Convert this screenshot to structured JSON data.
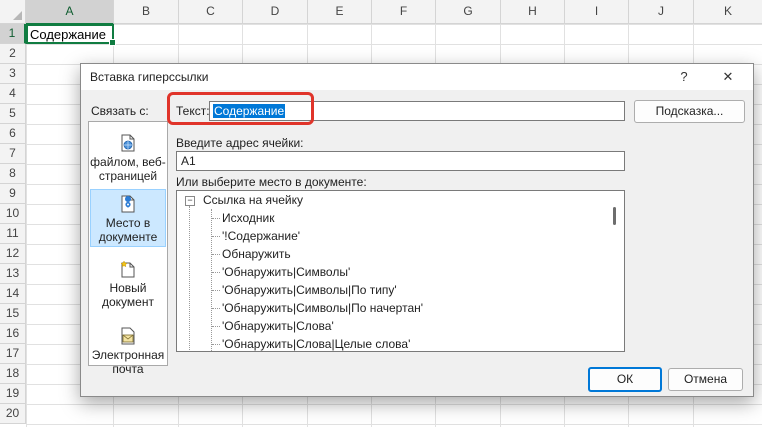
{
  "sheet": {
    "columns": [
      "A",
      "B",
      "C",
      "D",
      "E",
      "F",
      "G",
      "H",
      "I",
      "J",
      "K"
    ],
    "rows": [
      "1",
      "2",
      "3",
      "4",
      "5",
      "6",
      "7",
      "8",
      "9",
      "10",
      "11",
      "12",
      "13",
      "14",
      "15",
      "16",
      "17",
      "18",
      "19",
      "20"
    ],
    "a1_value": "Содержание"
  },
  "dialog": {
    "title": "Вставка гиперссылки",
    "help": "?",
    "close": "✕",
    "link_to_label": "Связать с:",
    "sidebar": [
      {
        "label": "файлом, веб-страницей",
        "line1": "файлом, веб-",
        "line2": "страницей",
        "icon": "web-page-icon"
      },
      {
        "label": "Место в документе",
        "line1": "Место в",
        "line2": "документе",
        "icon": "place-in-document-icon"
      },
      {
        "label": "Новый документ",
        "line1": "Новый",
        "line2": "документ",
        "icon": "new-document-icon"
      },
      {
        "label": "Электронная почта",
        "line1": "Электронная",
        "line2": "почта",
        "icon": "email-icon"
      }
    ],
    "text_label": "Текст:",
    "text_value": "Содержание",
    "tooltip_button": "Подсказка...",
    "address_label": "Введите адрес ячейки:",
    "address_value": "A1",
    "place_label": "Или выберите место в документе:",
    "tree": {
      "root": "Ссылка на ячейку",
      "items": [
        "Исходник",
        "'!Содержание'",
        "Обнаружить",
        "'Обнаружить|Символы'",
        "'Обнаружить|Символы|По типу'",
        "'Обнаружить|Символы|По начертан'",
        "'Обнаружить|Слова'",
        "'Обнаружить|Слова|Целые слова'"
      ]
    },
    "ok_button": "ОК",
    "cancel_button": "Отмена"
  },
  "colors": {
    "excel_green": "#107c41",
    "highlight_red": "#e0342a",
    "selection_blue": "#0078d7",
    "active_item_bg": "#cce8ff"
  }
}
